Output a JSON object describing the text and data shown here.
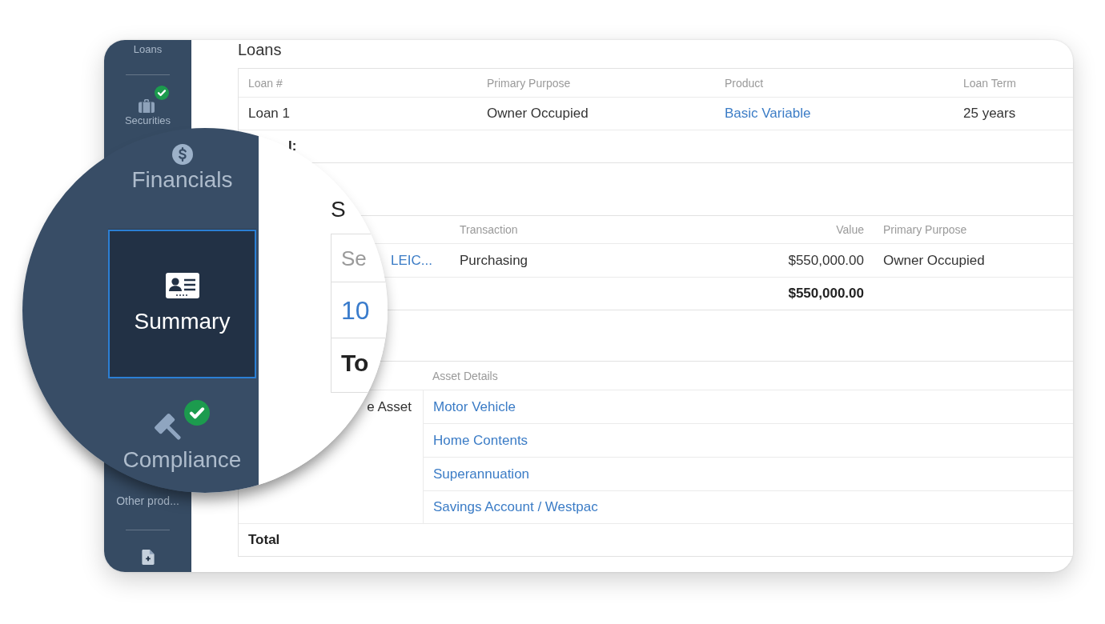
{
  "sidebar": {
    "items": [
      {
        "label": "Loans",
        "complete": false,
        "divider_after": true
      },
      {
        "label": "Securities",
        "complete": true,
        "divider_after": false
      },
      {
        "label": "Other prod...",
        "complete": false,
        "divider_after": true
      },
      {
        "complete": false,
        "divider_after": false
      }
    ]
  },
  "loans": {
    "title": "Loans",
    "columns": [
      "Loan #",
      "Primary Purpose",
      "Product",
      "Loan Term"
    ],
    "rows": [
      {
        "cells": [
          {
            "text": "Loan 1",
            "link": false
          },
          {
            "text": "Owner Occupied",
            "link": false
          },
          {
            "text": "Basic Variable",
            "link": true
          },
          {
            "text": "25 years",
            "link": false
          }
        ]
      }
    ],
    "total_label": "l:"
  },
  "securities": {
    "columns": [
      "",
      "Transaction",
      "Value",
      "Primary Purpose"
    ],
    "rows": [
      {
        "cells": [
          {
            "text": "LEIC...",
            "link": true
          },
          {
            "text": "Purchasing",
            "link": false
          },
          {
            "text": "$550,000.00",
            "link": false
          },
          {
            "text": "Owner Occupied",
            "link": false
          }
        ]
      }
    ],
    "total_value": "$550,000.00"
  },
  "assets": {
    "columns": [
      "",
      "Asset Details"
    ],
    "type_label": "e Asset",
    "rows": [
      {
        "text": "Motor Vehicle",
        "link": true
      },
      {
        "text": "Home Contents",
        "link": true
      },
      {
        "text": "Superannuation",
        "link": true
      },
      {
        "text": "Savings Account / Westpac",
        "link": true
      }
    ],
    "total_label": "Total"
  },
  "magnifier": {
    "nav_items": [
      {
        "label": "Financials",
        "selected": false,
        "complete": false
      },
      {
        "label": "Summary",
        "selected": true,
        "complete": false
      },
      {
        "label": "Compliance",
        "selected": false,
        "complete": true
      }
    ],
    "heading": "S",
    "rows": [
      {
        "text": "Se",
        "kind": "label"
      },
      {
        "text": "10",
        "kind": "link"
      },
      {
        "text": "To",
        "kind": "total"
      }
    ]
  }
}
